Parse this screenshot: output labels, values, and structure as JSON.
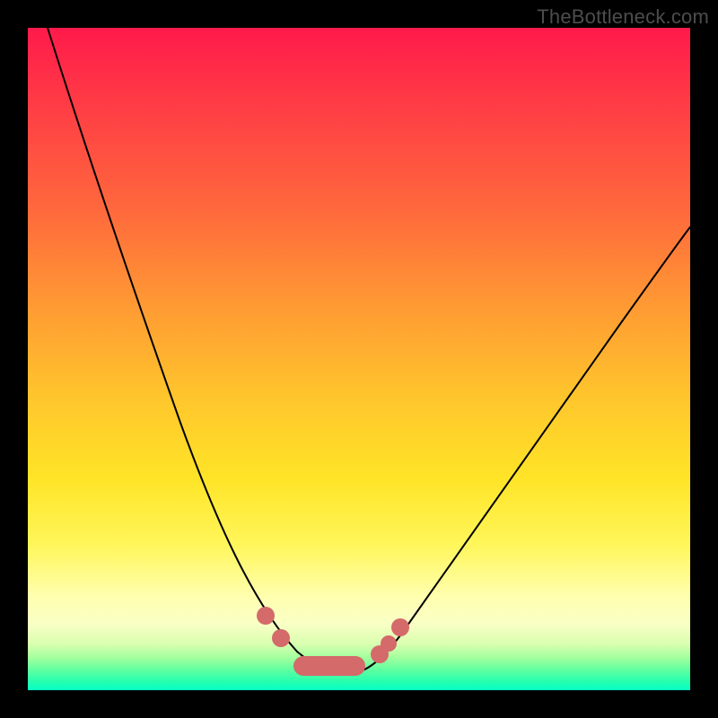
{
  "watermark": "TheBottleneck.com",
  "colors": {
    "frame": "#000000",
    "curve": "#000000",
    "marker": "#d46a6a",
    "gradient_top": "#ff1a4b",
    "gradient_bottom": "#06ffc6"
  },
  "chart_data": {
    "type": "line",
    "title": "",
    "xlabel": "",
    "ylabel": "",
    "xlim": [
      0,
      100
    ],
    "ylim": [
      0,
      100
    ],
    "series": [
      {
        "name": "bottleneck-curve",
        "x": [
          3,
          6,
          10,
          14,
          18,
          22,
          26,
          30,
          34,
          37,
          39,
          41,
          43,
          45,
          47,
          50,
          54,
          58,
          64,
          72,
          82,
          92,
          100
        ],
        "y": [
          100,
          88,
          74,
          61,
          49,
          39,
          30,
          23,
          16,
          11,
          8,
          6,
          4.5,
          3.5,
          3,
          3,
          4.5,
          7,
          12,
          21,
          34,
          49,
          62
        ]
      }
    ],
    "markers": {
      "name": "highlighted-points",
      "points": [
        {
          "x": 37,
          "y": 11
        },
        {
          "x": 39,
          "y": 8
        },
        {
          "x": 41,
          "y": 6
        },
        {
          "x": 43,
          "y": 4.5
        },
        {
          "x": 45,
          "y": 3.5
        },
        {
          "x": 47,
          "y": 3
        },
        {
          "x": 50,
          "y": 3
        },
        {
          "x": 53,
          "y": 4
        },
        {
          "x": 55,
          "y": 5.5
        },
        {
          "x": 57,
          "y": 7
        }
      ]
    }
  }
}
